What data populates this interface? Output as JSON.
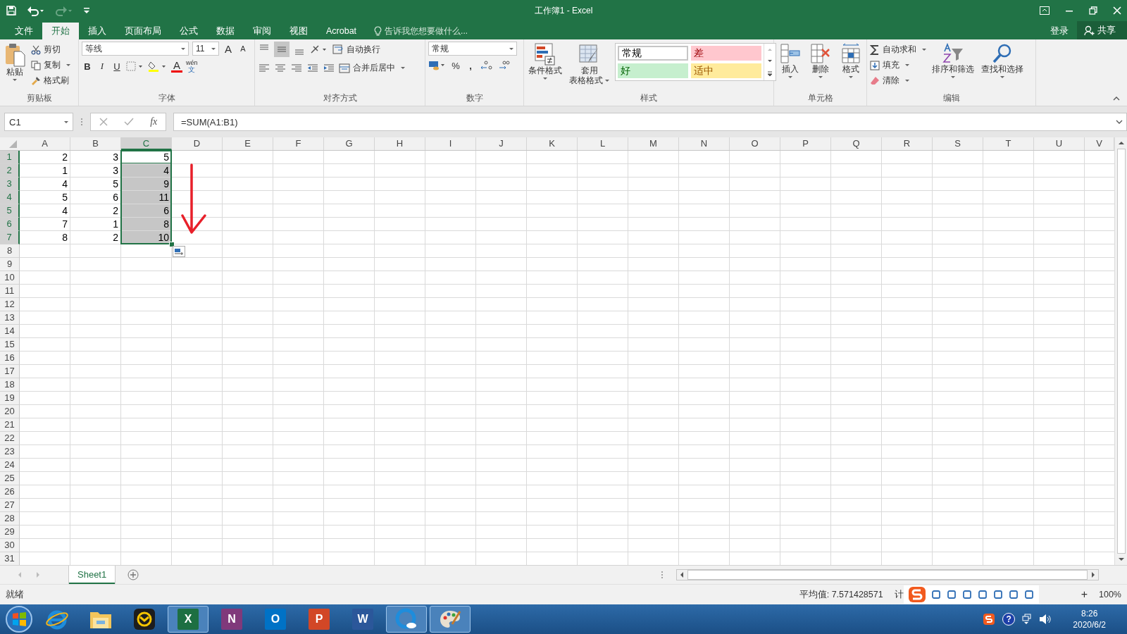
{
  "window": {
    "title": "工作簿1 - Excel"
  },
  "tabs": [
    {
      "label": "文件",
      "selected": false
    },
    {
      "label": "开始",
      "selected": true
    },
    {
      "label": "插入",
      "selected": false
    },
    {
      "label": "页面布局",
      "selected": false
    },
    {
      "label": "公式",
      "selected": false
    },
    {
      "label": "数据",
      "selected": false
    },
    {
      "label": "审阅",
      "selected": false
    },
    {
      "label": "视图",
      "selected": false
    },
    {
      "label": "Acrobat",
      "selected": false
    }
  ],
  "tell_me": {
    "placeholder": "告诉我您想要做什么..."
  },
  "account": {
    "sign_in": "登录",
    "share": "共享"
  },
  "ribbon": {
    "clipboard": {
      "paste": "粘贴",
      "cut": "剪切",
      "copy": "复制",
      "format_painter": "格式刷",
      "label": "剪贴板"
    },
    "font": {
      "name": "等线",
      "size": "11",
      "grow": "A",
      "shrink": "A",
      "bold": "B",
      "italic": "I",
      "underline": "U",
      "color_letter": "A",
      "phonetic": "wén",
      "phonetic_char": "文",
      "label": "字体"
    },
    "alignment": {
      "wrap": "自动换行",
      "merge": "合并后居中",
      "label": "对齐方式"
    },
    "number": {
      "format": "常规",
      "percent": "%",
      "comma": ",",
      "label": "数字"
    },
    "styles": {
      "conditional": "条件格式",
      "table_1": "套用",
      "table_2": "表格格式",
      "label": "样式",
      "cells": [
        {
          "label": "常规",
          "kind": "normal"
        },
        {
          "label": "差",
          "kind": "bad"
        },
        {
          "label": "好",
          "kind": "good"
        },
        {
          "label": "适中",
          "kind": "neutral"
        }
      ]
    },
    "cells": {
      "insert": "插入",
      "delete": "删除",
      "format": "格式",
      "label": "单元格"
    },
    "editing": {
      "autosum": "自动求和",
      "fill": "填充",
      "clear": "清除",
      "sort": "排序和筛选",
      "find": "查找和选择",
      "label": "编辑"
    }
  },
  "formula_bar": {
    "name_box": "C1",
    "fx": "fx",
    "formula": "=SUM(A1:B1)"
  },
  "sheet": {
    "columns": [
      {
        "label": "A",
        "selected": false
      },
      {
        "label": "B",
        "selected": false
      },
      {
        "label": "C",
        "selected": true
      },
      {
        "label": "D",
        "selected": false
      },
      {
        "label": "E",
        "selected": false
      },
      {
        "label": "F",
        "selected": false
      },
      {
        "label": "G",
        "selected": false
      },
      {
        "label": "H",
        "selected": false
      },
      {
        "label": "I",
        "selected": false
      },
      {
        "label": "J",
        "selected": false
      },
      {
        "label": "K",
        "selected": false
      },
      {
        "label": "L",
        "selected": false
      },
      {
        "label": "M",
        "selected": false
      },
      {
        "label": "N",
        "selected": false
      },
      {
        "label": "O",
        "selected": false
      },
      {
        "label": "P",
        "selected": false
      },
      {
        "label": "Q",
        "selected": false
      },
      {
        "label": "R",
        "selected": false
      },
      {
        "label": "S",
        "selected": false
      },
      {
        "label": "T",
        "selected": false
      },
      {
        "label": "U",
        "selected": false
      },
      {
        "label": "V",
        "selected": false
      }
    ],
    "rows": [
      {
        "number": "1",
        "selected": true,
        "cells": [
          {
            "value": "2",
            "selected": false,
            "active": false
          },
          {
            "value": "3",
            "selected": false,
            "active": false
          },
          {
            "value": "5",
            "selected": false,
            "active": true
          }
        ]
      },
      {
        "number": "2",
        "selected": true,
        "cells": [
          {
            "value": "1",
            "selected": false,
            "active": false
          },
          {
            "value": "3",
            "selected": false,
            "active": false
          },
          {
            "value": "4",
            "selected": true,
            "active": false
          }
        ]
      },
      {
        "number": "3",
        "selected": true,
        "cells": [
          {
            "value": "4",
            "selected": false,
            "active": false
          },
          {
            "value": "5",
            "selected": false,
            "active": false
          },
          {
            "value": "9",
            "selected": true,
            "active": false
          }
        ]
      },
      {
        "number": "4",
        "selected": true,
        "cells": [
          {
            "value": "5",
            "selected": false,
            "active": false
          },
          {
            "value": "6",
            "selected": false,
            "active": false
          },
          {
            "value": "11",
            "selected": true,
            "active": false
          }
        ]
      },
      {
        "number": "5",
        "selected": true,
        "cells": [
          {
            "value": "4",
            "selected": false,
            "active": false
          },
          {
            "value": "2",
            "selected": false,
            "active": false
          },
          {
            "value": "6",
            "selected": true,
            "active": false
          }
        ]
      },
      {
        "number": "6",
        "selected": true,
        "cells": [
          {
            "value": "7",
            "selected": false,
            "active": false
          },
          {
            "value": "1",
            "selected": false,
            "active": false
          },
          {
            "value": "8",
            "selected": true,
            "active": false
          }
        ]
      },
      {
        "number": "7",
        "selected": true,
        "cells": [
          {
            "value": "8",
            "selected": false,
            "active": false
          },
          {
            "value": "2",
            "selected": false,
            "active": false
          },
          {
            "value": "10",
            "selected": true,
            "active": false
          }
        ]
      },
      {
        "number": "8",
        "selected": false
      },
      {
        "number": "9",
        "selected": false
      },
      {
        "number": "10",
        "selected": false
      },
      {
        "number": "11",
        "selected": false
      },
      {
        "number": "12",
        "selected": false
      },
      {
        "number": "13",
        "selected": false
      },
      {
        "number": "14",
        "selected": false
      },
      {
        "number": "15",
        "selected": false
      },
      {
        "number": "16",
        "selected": false
      },
      {
        "number": "17",
        "selected": false
      },
      {
        "number": "18",
        "selected": false
      },
      {
        "number": "19",
        "selected": false
      },
      {
        "number": "20",
        "selected": false
      },
      {
        "number": "21",
        "selected": false
      },
      {
        "number": "22",
        "selected": false
      },
      {
        "number": "23",
        "selected": false
      },
      {
        "number": "24",
        "selected": false
      },
      {
        "number": "25",
        "selected": false
      },
      {
        "number": "26",
        "selected": false
      },
      {
        "number": "27",
        "selected": false
      },
      {
        "number": "28",
        "selected": false
      },
      {
        "number": "29",
        "selected": false
      },
      {
        "number": "30",
        "selected": false
      },
      {
        "number": "31",
        "selected": false
      }
    ]
  },
  "sheet_tabs": [
    {
      "label": "Sheet1",
      "selected": true
    }
  ],
  "status_bar": {
    "ready": "就绪",
    "average": "平均值: 7.571428571",
    "count": "计",
    "zoom_in": "+",
    "zoom": "100%"
  },
  "taskbar": {
    "apps": [
      {
        "kind": "ie",
        "selected": false
      },
      {
        "kind": "explorer",
        "selected": false
      },
      {
        "kind": "g",
        "selected": false
      },
      {
        "kind": "excel",
        "letter": "X",
        "selected": true
      },
      {
        "kind": "onenote",
        "letter": "N",
        "selected": false
      },
      {
        "kind": "outlook",
        "letter": "O",
        "selected": false
      },
      {
        "kind": "powerpoint",
        "letter": "P",
        "selected": false
      },
      {
        "kind": "word",
        "letter": "W",
        "selected": false
      },
      {
        "kind": "browser",
        "selected": true
      },
      {
        "kind": "paint",
        "selected": true
      }
    ],
    "tray": {
      "help": "?",
      "time": "8:26",
      "date": "2020/6/2"
    }
  }
}
